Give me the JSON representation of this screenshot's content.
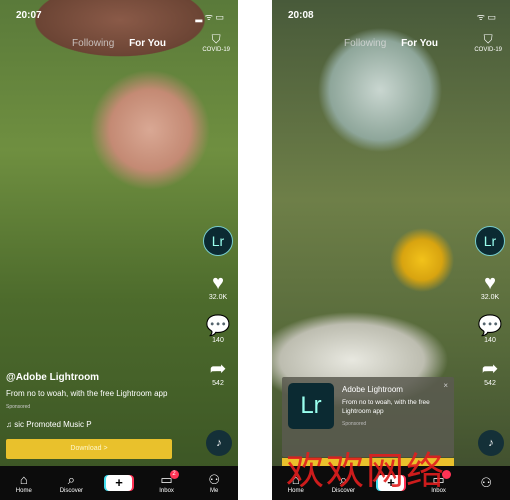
{
  "screens": [
    {
      "time": "20:07",
      "tabs": {
        "following": "Following",
        "for_you": "For You"
      },
      "covid": "COVID-19",
      "avatar": "Lr",
      "likes": "32.0K",
      "comments": "140",
      "shares": "542",
      "caption": {
        "user": "@Adobe Lightroom",
        "text": "From no to woah, with the free Lightroom app",
        "sponsored": "Sponsored"
      },
      "music": "♫ sic   Promoted Music   P",
      "download": "Download >"
    },
    {
      "time": "20:08",
      "tabs": {
        "following": "Following",
        "for_you": "For You"
      },
      "covid": "COVID-19",
      "avatar": "Lr",
      "likes": "32.0K",
      "comments": "140",
      "shares": "542",
      "card": {
        "logo": "Lr",
        "title": "Adobe Lightroom",
        "text": "From no to woah, with the free Lightroom app",
        "sponsored": "Sponsored",
        "close": "×"
      }
    }
  ],
  "nav": {
    "home": "Home",
    "discover": "Discover",
    "inbox": "Inbox",
    "me": "Me",
    "inbox_badge": "2"
  },
  "watermark": "欢欢网络",
  "colors": {
    "download": "#e9c12c",
    "lr_bg": "#0b2a32",
    "badge": "#ff3355"
  }
}
